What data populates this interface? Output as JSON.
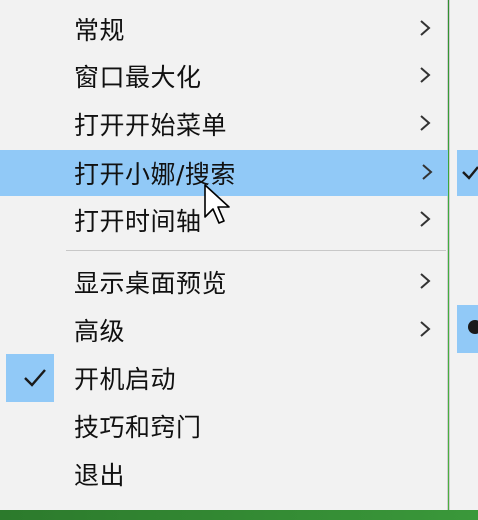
{
  "menu": {
    "items": [
      {
        "label": "常规",
        "has_submenu": true
      },
      {
        "label": "窗口最大化",
        "has_submenu": true
      },
      {
        "label": "打开开始菜单",
        "has_submenu": true
      },
      {
        "label": "打开小娜/搜索",
        "has_submenu": true,
        "highlighted": true
      },
      {
        "label": "打开时间轴",
        "has_submenu": true
      },
      {
        "label": "显示桌面预览",
        "has_submenu": true
      },
      {
        "label": "高级",
        "has_submenu": true
      },
      {
        "label": "开机启动",
        "checked": true
      },
      {
        "label": "技巧和窍门"
      },
      {
        "label": "退出"
      }
    ]
  },
  "icons": {
    "submenu_arrow": "chevron-right-icon",
    "check": "checkmark-icon",
    "cursor": "mouse-pointer-icon"
  },
  "colors": {
    "highlight": "#91c9f7",
    "menu_bg": "#f2f2f2",
    "text": "#111111",
    "desktop": "#3f9a3a"
  }
}
